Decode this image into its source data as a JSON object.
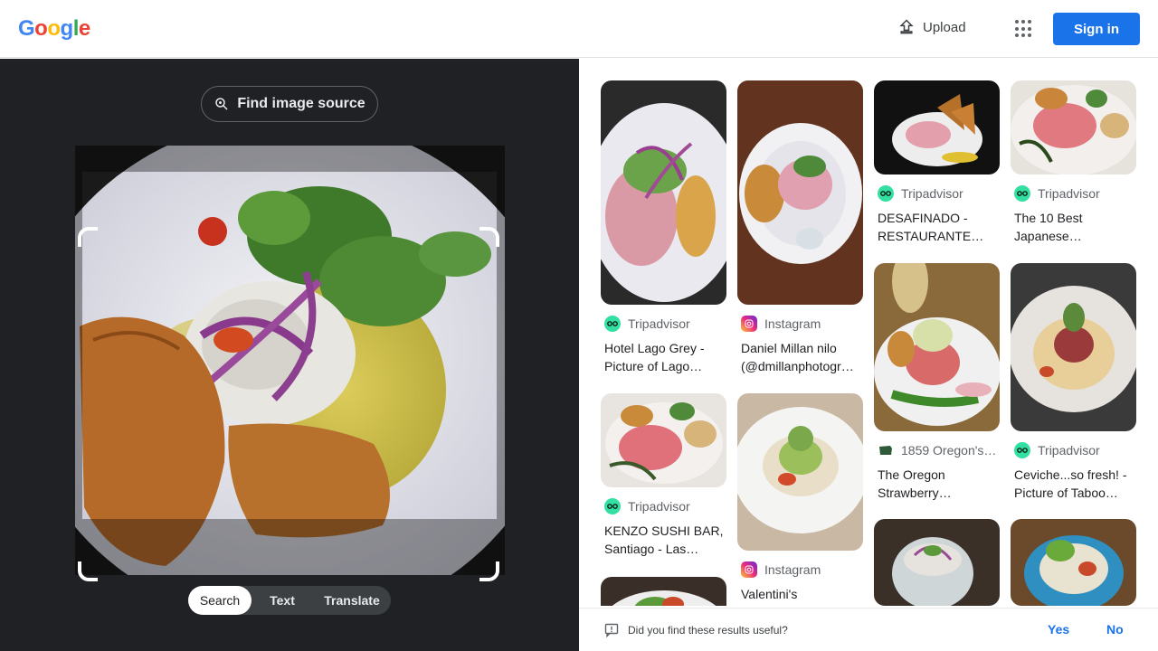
{
  "header": {
    "logo_letters": [
      "G",
      "o",
      "o",
      "g",
      "l",
      "e"
    ],
    "logo_colors": [
      "#4285F4",
      "#EA4335",
      "#FBBC05",
      "#4285F4",
      "#34A853",
      "#EA4335"
    ],
    "upload_label": "Upload",
    "apps_icon": "apps-grid-icon",
    "signin_label": "Sign in",
    "accent": "#1a73e8"
  },
  "lens": {
    "find_source_label": "Find image source",
    "modes": [
      {
        "label": "Search",
        "active": true
      },
      {
        "label": "Text",
        "active": false
      },
      {
        "label": "Translate",
        "active": false
      }
    ]
  },
  "results": [
    {
      "source": "Tripadvisor",
      "source_icon": "tripadvisor-icon",
      "title": "Hotel Lago Grey - Picture of Lago…"
    },
    {
      "source": "Instagram",
      "source_icon": "instagram-icon",
      "title": "Daniel Millan nilo (@dmillanphotogr…"
    },
    {
      "source": "Tripadvisor",
      "source_icon": "tripadvisor-icon",
      "title": "DESAFINADO - RESTAURANTE…"
    },
    {
      "source": "Tripadvisor",
      "source_icon": "tripadvisor-icon",
      "title": "The 10 Best Japanese…"
    },
    {
      "source": "Tripadvisor",
      "source_icon": "tripadvisor-icon",
      "title": "KENZO SUSHI BAR, Santiago - Las…"
    },
    {
      "source": "Instagram",
      "source_icon": "instagram-icon",
      "title": "Valentini's"
    },
    {
      "source": "1859 Oregon's …",
      "source_icon": "oregon-icon",
      "title": "The Oregon Strawberry…"
    },
    {
      "source": "Tripadvisor",
      "source_icon": "tripadvisor-icon",
      "title": "Ceviche...so fresh! - Picture of Taboo…"
    }
  ],
  "feedback": {
    "question": "Did you find these results useful?",
    "yes_label": "Yes",
    "no_label": "No"
  }
}
